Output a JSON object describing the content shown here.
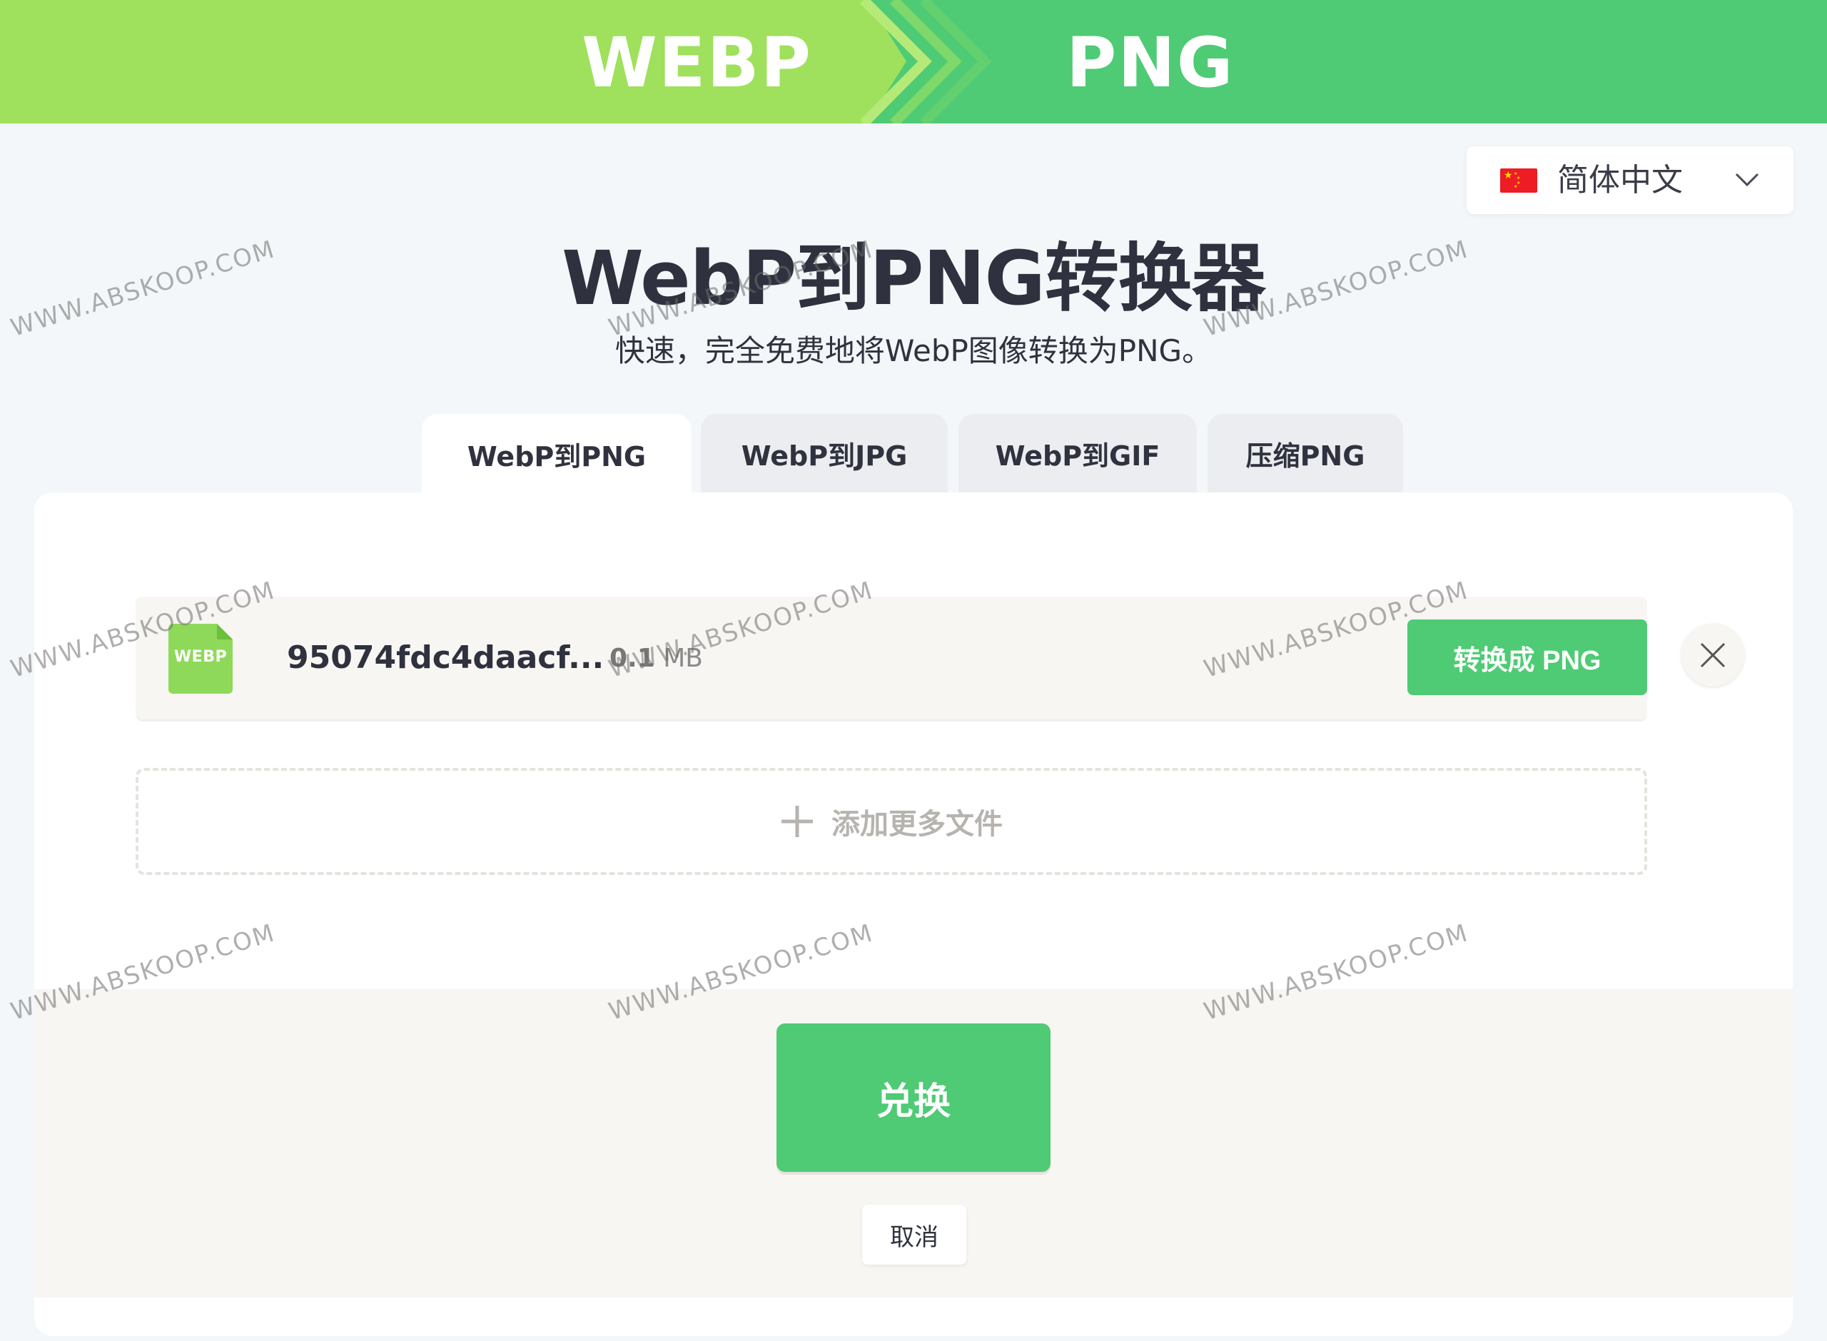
{
  "banner": {
    "from_format": "WEBP",
    "to_format": "PNG"
  },
  "language": {
    "current": "简体中文",
    "flag_icon": "china-flag-icon"
  },
  "header": {
    "title": "WebP到PNG转换器",
    "subtitle": "快速，完全免费地将WebP图像转换为PNG。"
  },
  "tabs": [
    {
      "label": "WebP到PNG",
      "active": true
    },
    {
      "label": "WebP到JPG",
      "active": false
    },
    {
      "label": "WebP到GIF",
      "active": false
    },
    {
      "label": "压缩PNG",
      "active": false
    }
  ],
  "file": {
    "type_badge": "WEBP",
    "name": "95074fdc4daacf...",
    "size_value": "0.1",
    "size_unit": "MB",
    "convert_label": "转换成 PNG"
  },
  "add_more": {
    "label": "添加更多文件"
  },
  "actions": {
    "convert_label": "兑换",
    "cancel_label": "取消"
  },
  "watermark": {
    "text": "WWW.ABSKOOP.COM"
  },
  "colors": {
    "banner_left": "#9fe05c",
    "banner_right": "#4ecb74",
    "accent_green": "#4ecb74",
    "background": "#f4f7f9",
    "title_text": "#2f313e"
  }
}
